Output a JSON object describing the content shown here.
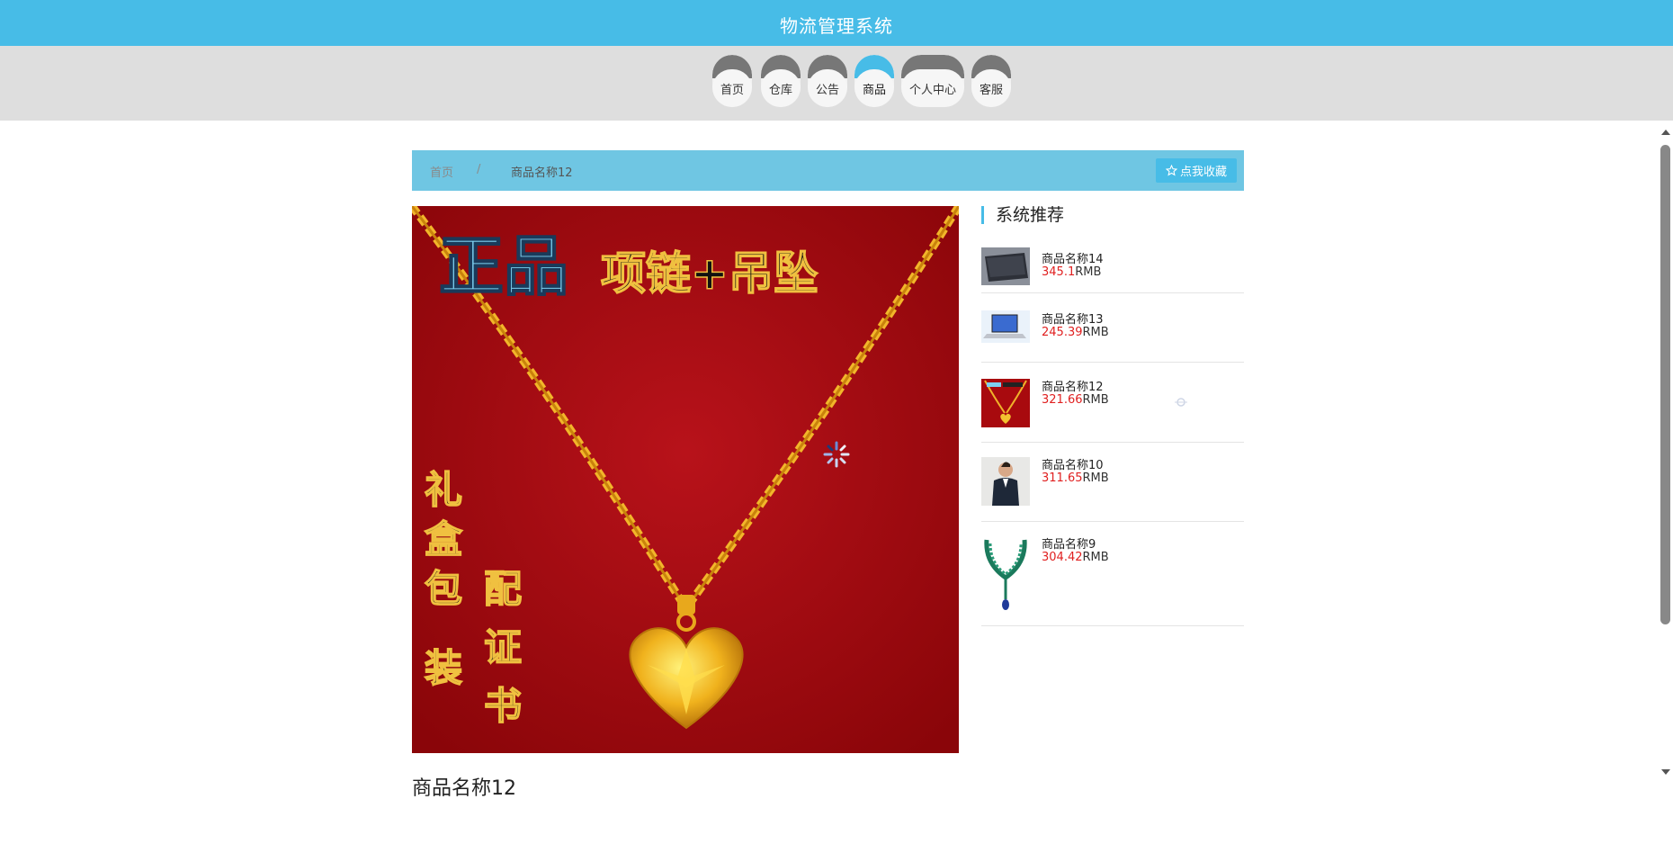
{
  "header": {
    "title": "物流管理系统"
  },
  "nav": {
    "items": [
      {
        "label": "首页",
        "active": false
      },
      {
        "label": "仓库",
        "active": false
      },
      {
        "label": "公告",
        "active": false
      },
      {
        "label": "商品",
        "active": true
      },
      {
        "label": "个人中心",
        "active": false
      },
      {
        "label": "客服",
        "active": false
      }
    ]
  },
  "breadcrumb": {
    "home": "首页",
    "separator": "/",
    "current": "商品名称12",
    "favorite_button": "点我收藏",
    "favorite_icon": "star-outline-icon"
  },
  "product": {
    "name": "商品名称12",
    "image": {
      "banner_text_1": "正品",
      "banner_text_2": "项链+吊坠",
      "side_text_1": "礼盒包装",
      "side_text_2": "配证书"
    }
  },
  "recommend": {
    "title": "系统推荐",
    "currency": "RMB",
    "items": [
      {
        "name": "商品名称14",
        "price": "345.1",
        "thumb": "laptop-dark"
      },
      {
        "name": "商品名称13",
        "price": "245.39",
        "thumb": "laptop-light"
      },
      {
        "name": "商品名称12",
        "price": "321.66",
        "thumb": "gold-necklace"
      },
      {
        "name": "商品名称10",
        "price": "311.65",
        "thumb": "man-suit"
      },
      {
        "name": "商品名称9",
        "price": "304.42",
        "thumb": "emerald-necklace"
      }
    ]
  },
  "colors": {
    "accent": "#47bce7",
    "breadcrumb_bg": "#6fc6e3",
    "price": "#e02020"
  }
}
